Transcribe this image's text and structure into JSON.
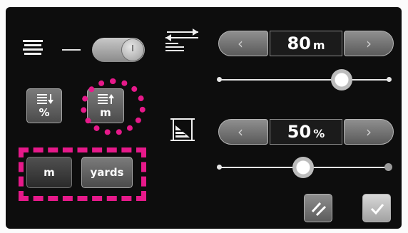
{
  "top_left": {
    "spacing_icon": "line-spacing-icon",
    "toggle": {
      "state": "on",
      "icon": "power-knob-icon"
    }
  },
  "unit_mode": {
    "percent_button": {
      "icon": "spacing-down-icon",
      "label": "%"
    },
    "meters_button": {
      "icon": "spacing-up-icon",
      "label": "m"
    }
  },
  "length_units": {
    "meters_label": "m",
    "yards_label": "yards",
    "selected": "m"
  },
  "distance_control": {
    "icon": "distance-adjust-icon",
    "decrement_icon": "chevron-left-icon",
    "increment_icon": "chevron-right-icon",
    "value": "80",
    "unit": "m",
    "slider_fraction": 0.72
  },
  "percent_control": {
    "icon": "area-percent-icon",
    "decrement_icon": "chevron-left-icon",
    "increment_icon": "chevron-right-icon",
    "value": "50",
    "unit": "%",
    "slider_fraction": 0.5
  },
  "actions": {
    "reset_icon": "double-slash-icon",
    "confirm_icon": "check-icon"
  },
  "colors": {
    "highlight": "#e6198a",
    "background": "#0d0d0d"
  }
}
